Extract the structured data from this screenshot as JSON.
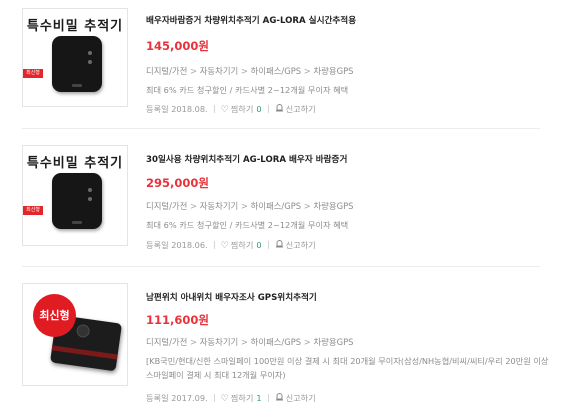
{
  "items": [
    {
      "thumb_title": "특수비밀 추적기",
      "ribbon": "최신형",
      "title": "배우자바람증거 차량위치추적기 AG-LORA 실시간추적용",
      "price": "145,000원",
      "category": [
        "디지털/가전",
        "자동차기기",
        "하이패스/GPS",
        "차량용GPS"
      ],
      "benefit": "최대 6% 카드 청구할인 / 카드사별 2~12개월 무이자 혜택",
      "registered": "등록일 2018.08.",
      "wish_label": "찜하기",
      "wish_count": "0",
      "report_label": "신고하기"
    },
    {
      "thumb_title": "특수비밀 추적기",
      "ribbon": "최신형",
      "title": "30일사용 차량위치추적기 AG-LORA 배우자 바람증거",
      "price": "295,000원",
      "category": [
        "디지털/가전",
        "자동차기기",
        "하이패스/GPS",
        "차량용GPS"
      ],
      "benefit": "최대 6% 카드 청구할인 / 카드사별 2~12개월 무이자 혜택",
      "registered": "등록일 2018.06.",
      "wish_label": "찜하기",
      "wish_count": "0",
      "report_label": "신고하기"
    },
    {
      "badge": "최신형",
      "title": "남편위치 아내위치 배우자조사 GPS위치추적기",
      "price": "111,600원",
      "category": [
        "디지털/가전",
        "자동차기기",
        "하이패스/GPS",
        "차량용GPS"
      ],
      "benefit": "[KB국민/현대/신한 스마일페이 100만원 이상 결제 시 최대 20개월 무이자(삼성/NH농협/비씨/씨티/우리 20만원 이상 스마일페이 결제 시 최대 12개월 무이자)",
      "registered": "등록일 2017.09.",
      "wish_label": "찜하기",
      "wish_count": "1",
      "report_label": "신고하기"
    }
  ],
  "colors": {
    "price": "#e8323c",
    "wish_count": "#2e9b7d",
    "badge": "#e11b22"
  }
}
